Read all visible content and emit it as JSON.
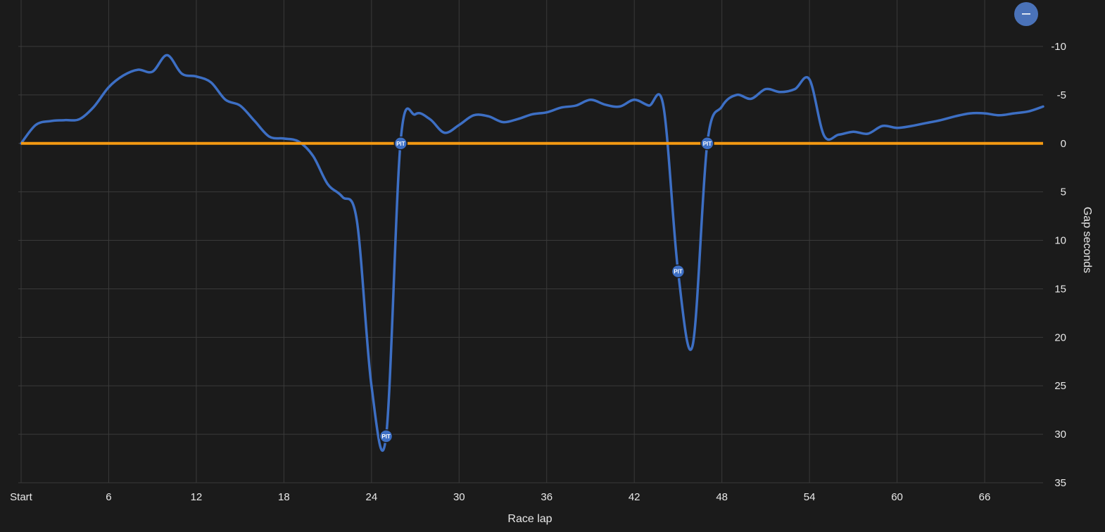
{
  "colors": {
    "background": "#1b1b1b",
    "grid": "#3a3a3a",
    "driver_line": "#3d6fc4",
    "reference_line": "#f59a12",
    "pit_marker": "#3d6fc4",
    "button": "#4a72b8"
  },
  "controls": {
    "toggle_button_label": "−",
    "toggle_icon": "minus-icon"
  },
  "chart_data": {
    "type": "line",
    "xlabel": "Race lap",
    "ylabel": "Gap seconds",
    "xlim": [
      0,
      70
    ],
    "ylim": [
      -10,
      35
    ],
    "y_inverted": true,
    "grid": true,
    "x_ticks": [
      {
        "value": 0,
        "label": "Start"
      },
      {
        "value": 6,
        "label": "6"
      },
      {
        "value": 12,
        "label": "12"
      },
      {
        "value": 18,
        "label": "18"
      },
      {
        "value": 24,
        "label": "24"
      },
      {
        "value": 30,
        "label": "30"
      },
      {
        "value": 36,
        "label": "36"
      },
      {
        "value": 42,
        "label": "42"
      },
      {
        "value": 48,
        "label": "48"
      },
      {
        "value": 54,
        "label": "54"
      },
      {
        "value": 60,
        "label": "60"
      },
      {
        "value": 66,
        "label": "66"
      }
    ],
    "y_ticks": [
      {
        "value": -10,
        "label": "-10"
      },
      {
        "value": -5,
        "label": "-5"
      },
      {
        "value": 0,
        "label": "0"
      },
      {
        "value": 5,
        "label": "5"
      },
      {
        "value": 10,
        "label": "10"
      },
      {
        "value": 15,
        "label": "15"
      },
      {
        "value": 20,
        "label": "20"
      },
      {
        "value": 25,
        "label": "25"
      },
      {
        "value": 30,
        "label": "30"
      },
      {
        "value": 35,
        "label": "35"
      }
    ],
    "reference": {
      "y": 0
    },
    "series": [
      {
        "x": [
          0,
          1,
          2,
          3,
          4,
          5,
          6,
          7,
          8,
          9,
          10,
          11,
          12,
          13,
          14,
          15,
          16,
          17,
          18,
          19,
          20,
          21,
          22,
          23,
          24,
          25,
          26,
          27,
          28,
          29,
          30,
          31,
          32,
          33,
          34,
          35,
          36,
          37,
          38,
          39,
          40,
          41,
          42,
          43,
          44,
          45,
          46,
          47,
          48,
          49,
          50,
          51,
          52,
          53,
          54,
          55,
          56,
          57,
          58,
          59,
          60,
          61,
          62,
          63,
          64,
          65,
          66,
          67,
          68,
          69,
          70
        ],
        "y": [
          0,
          -1.9,
          -2.3,
          -2.4,
          -2.5,
          -3.8,
          -5.8,
          -7.0,
          -7.6,
          -7.4,
          -9.1,
          -7.2,
          -6.9,
          -6.3,
          -4.5,
          -3.9,
          -2.3,
          -0.7,
          -0.5,
          -0.2,
          1.3,
          4.2,
          5.5,
          8.0,
          25.0,
          30.2,
          -0.3,
          -3.0,
          -2.5,
          -1.1,
          -1.9,
          -2.9,
          -2.8,
          -2.2,
          -2.5,
          -3.0,
          -3.2,
          -3.7,
          -3.9,
          -4.5,
          -4.0,
          -3.8,
          -4.5,
          -3.9,
          -3.8,
          13.2,
          20.8,
          0.0,
          -3.8,
          -5.0,
          -4.6,
          -5.6,
          -5.3,
          -5.6,
          -6.6,
          -0.8,
          -0.9,
          -1.2,
          -1.0,
          -1.8,
          -1.6,
          -1.8,
          -2.1,
          -2.4,
          -2.8,
          -3.1,
          -3.1,
          -2.9,
          -3.1,
          -3.3,
          -3.8
        ]
      },
      {
        "x": [
          0,
          70
        ],
        "y": [
          0,
          0
        ]
      }
    ],
    "annotations": [
      {
        "x": 26,
        "y": 0,
        "text": "PIT"
      },
      {
        "x": 25,
        "y": 30.2,
        "text": "PIT"
      },
      {
        "x": 45,
        "y": 13.2,
        "text": "PIT"
      },
      {
        "x": 47,
        "y": 0,
        "text": "PIT"
      }
    ]
  }
}
